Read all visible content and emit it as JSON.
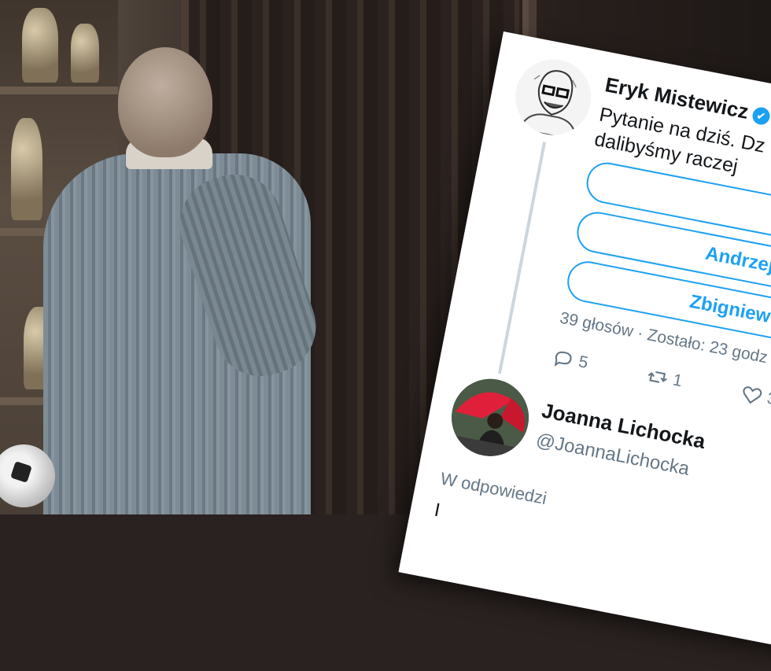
{
  "tweet": {
    "author_name": "Eryk Mistewicz",
    "verified_symbol": "✔",
    "text_line_1": "Pytanie na dziś. Dz",
    "text_line_2": "dalibyśmy raczej",
    "poll_options": [
      "",
      "Andrzej",
      "Zbigniew"
    ],
    "poll_meta": "39 głosów · Zostało: 23 godz",
    "actions": {
      "reply_count": "5",
      "retweet_count": "1",
      "like_count": "3"
    }
  },
  "reply": {
    "author_name": "Joanna Lichocka",
    "handle": "@JoannaLichocka",
    "context": "W odpowiedzi",
    "body_start": "I"
  },
  "colors": {
    "accent": "#1da1f2",
    "text": "#14171a",
    "muted": "#657786",
    "thread_line": "#ccd6dd"
  },
  "icons": [
    "verified-badge-icon",
    "reply-icon",
    "retweet-icon",
    "like-icon"
  ]
}
